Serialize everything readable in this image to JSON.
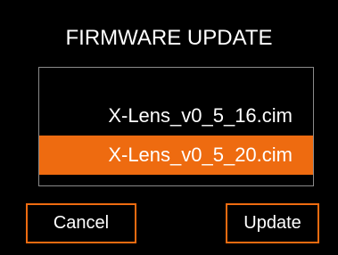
{
  "dialog": {
    "title": "FIRMWARE UPDATE"
  },
  "file_list": {
    "items": [
      {
        "label": "X-Lens_v0_5_16.cim",
        "selected": false
      },
      {
        "label": "X-Lens_v0_5_20.cim",
        "selected": true
      }
    ]
  },
  "buttons": {
    "cancel_label": "Cancel",
    "update_label": "Update"
  },
  "colors": {
    "background": "#000000",
    "accent": "#ee6b10",
    "text": "#ffffff",
    "list_border": "#8a8a8a"
  }
}
